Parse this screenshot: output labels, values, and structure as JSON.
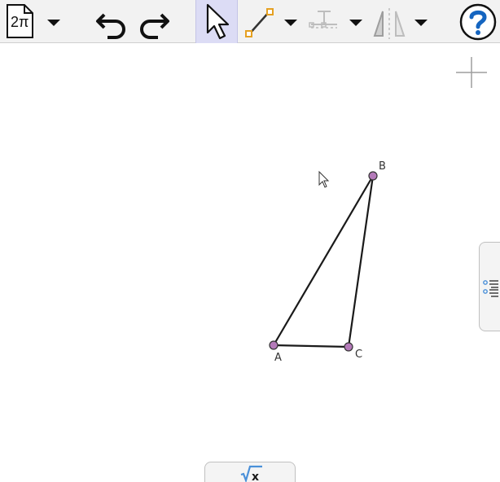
{
  "toolbar": {
    "menu_icon_text": "2π",
    "tools": [
      {
        "name": "menu",
        "icon": "file-2pi-icon"
      },
      {
        "name": "undo",
        "icon": "undo-icon"
      },
      {
        "name": "redo",
        "icon": "redo-icon"
      },
      {
        "name": "move",
        "icon": "pointer-arrow-icon",
        "active": true
      },
      {
        "name": "segment",
        "icon": "segment-icon"
      },
      {
        "name": "perpendicular",
        "icon": "perpendicular-icon",
        "disabled": true
      },
      {
        "name": "reflect",
        "icon": "reflect-icon",
        "disabled": true
      },
      {
        "name": "help",
        "icon": "help-icon"
      }
    ]
  },
  "geometry": {
    "points": [
      {
        "label": "A"
      },
      {
        "label": "B"
      },
      {
        "label": "C"
      }
    ],
    "polygon": "ABC"
  },
  "side_panel": {
    "icon": "algebra-list-icon"
  },
  "input_bar": {
    "icon": "sqrt-x-icon",
    "label": "√x"
  },
  "colors": {
    "toolbar_bg": "#f2f2f2",
    "active_tool_bg": "#dcdcf5",
    "point_fill": "#b47ab9",
    "segment_color": "#1a1a1a",
    "help_blue": "#1565c0",
    "accent_orange": "#e5a021",
    "accent_blue": "#4a90d9"
  }
}
